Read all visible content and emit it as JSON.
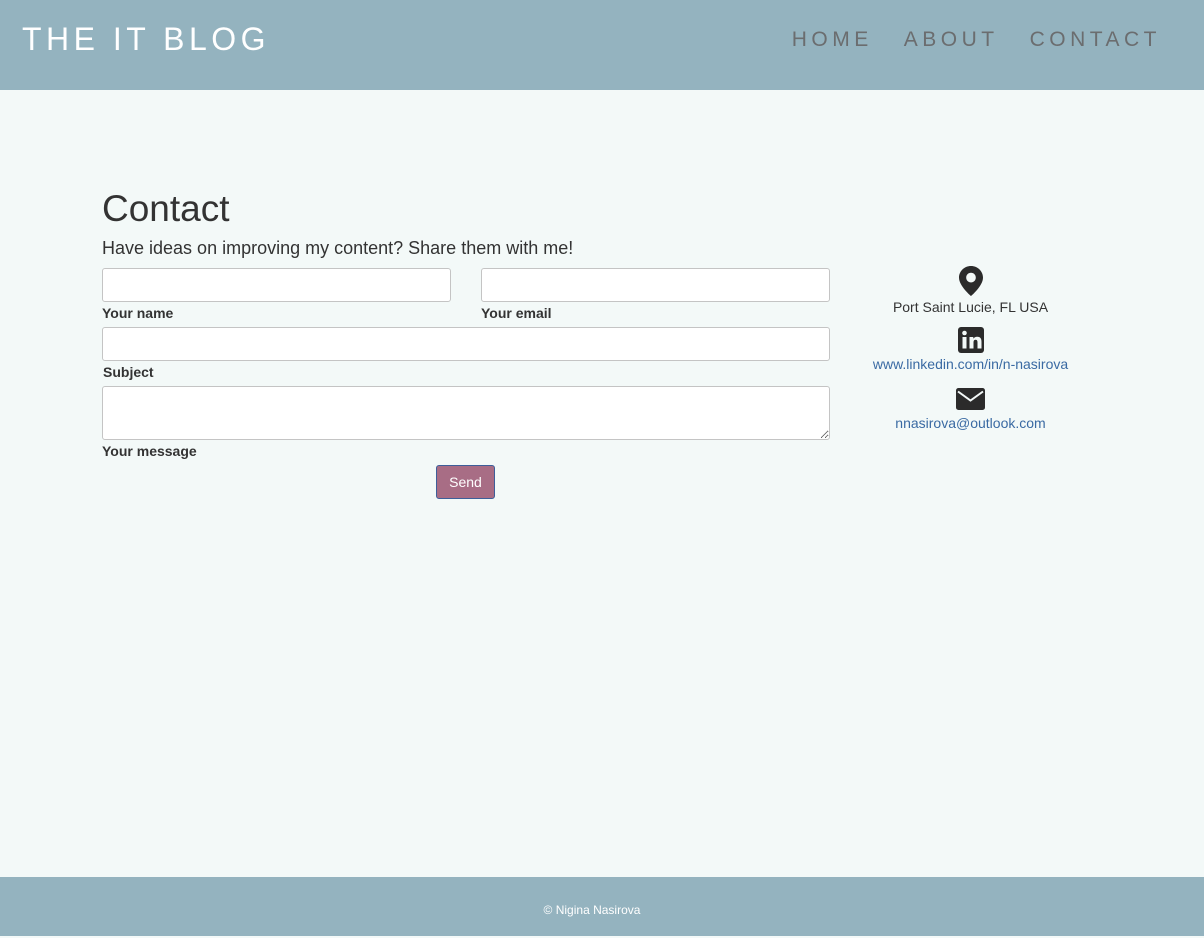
{
  "header": {
    "brand": "THE IT BLOG",
    "nav": [
      "HOME",
      "ABOUT",
      "CONTACT"
    ]
  },
  "contact": {
    "title": "Contact",
    "subtitle": "Have ideas on improving my content? Share them with me!",
    "form": {
      "name_label": "Your name",
      "name_value": "",
      "email_label": "Your email",
      "email_value": "",
      "subject_label": "Subject",
      "subject_value": "",
      "message_label": "Your message",
      "message_value": "",
      "send_label": "Send"
    },
    "info": {
      "location": "Port Saint Lucie, FL USA",
      "linkedin": "www.linkedin.com/in/n-nasirova",
      "email": "nnasirova@outlook.com",
      "icons": [
        "location-pin-icon",
        "linkedin-icon",
        "envelope-icon"
      ]
    }
  },
  "colors": {
    "header_bg": "#94b3bf",
    "page_bg": "#f3f9f8",
    "button_bg": "#a86d85",
    "link": "#3a6aa3"
  },
  "footer": {
    "text": "© Nigina Nasirova"
  }
}
